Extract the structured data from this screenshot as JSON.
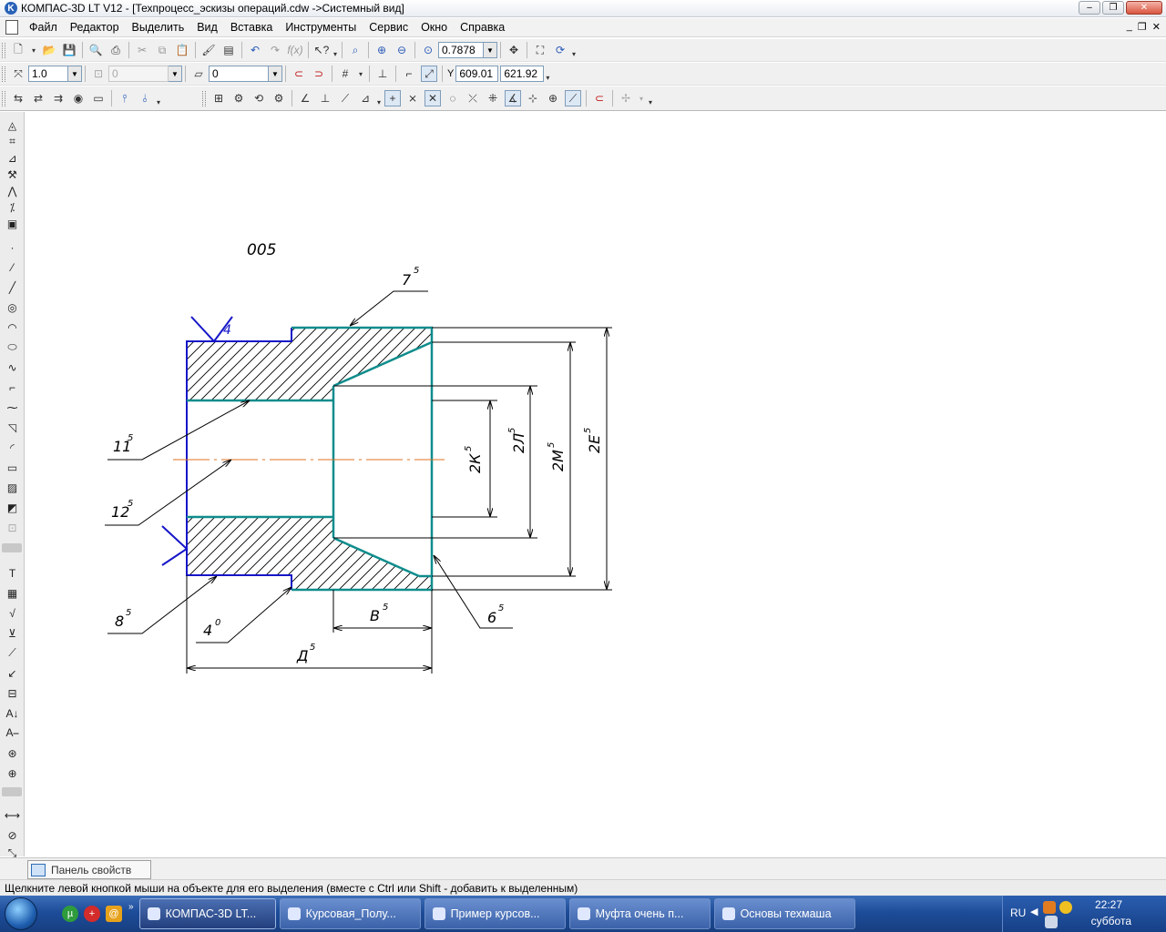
{
  "window": {
    "title": "КОМПАС-3D LT V12 - [Техпроцесс_эскизы операций.cdw ->Системный вид]",
    "app_icon": "K"
  },
  "menu": [
    "Файл",
    "Редактор",
    "Выделить",
    "Вид",
    "Вставка",
    "Инструменты",
    "Сервис",
    "Окно",
    "Справка"
  ],
  "toolbar1": {
    "zoom_value": "0.7878"
  },
  "toolbar2": {
    "step_value": "1.0",
    "angle_value": "0",
    "layer_value": "0",
    "coord_label": "Y",
    "x_value": "609.01",
    "y_value": "621.92"
  },
  "drawing": {
    "operation_number": "005",
    "roughness_top": "4",
    "dimension_labels": {
      "d7": "7",
      "d11": "11",
      "d12": "12",
      "d8": "8",
      "d4": "4",
      "dD": "Д",
      "dB": "В",
      "d6": "6",
      "d2K": "2К",
      "d2L": "2Л",
      "d2M": "2М",
      "d2E": "2Е"
    },
    "superscripts": {
      "s5": "5",
      "s0": "0"
    },
    "colors": {
      "outline_blue": "#1515c8",
      "outline_teal": "#0f8c8c",
      "axis": "#e07020",
      "dimension": "#000000"
    }
  },
  "properties_tab": "Панель свойств",
  "status_text": "Щелкните левой кнопкой мыши на объекте для его выделения (вместе с Ctrl или Shift - добавить к выделенным)",
  "taskbar": {
    "quick_more": "»",
    "tasks": [
      {
        "label": "КОМПАС-3D LT..."
      },
      {
        "label": "Курсовая_Полу..."
      },
      {
        "label": "Пример курсов..."
      },
      {
        "label": "Муфта очень п..."
      },
      {
        "label": "Основы техмаша"
      }
    ],
    "tray": {
      "lang": "RU",
      "time": "22:27",
      "day": "суббота"
    }
  }
}
